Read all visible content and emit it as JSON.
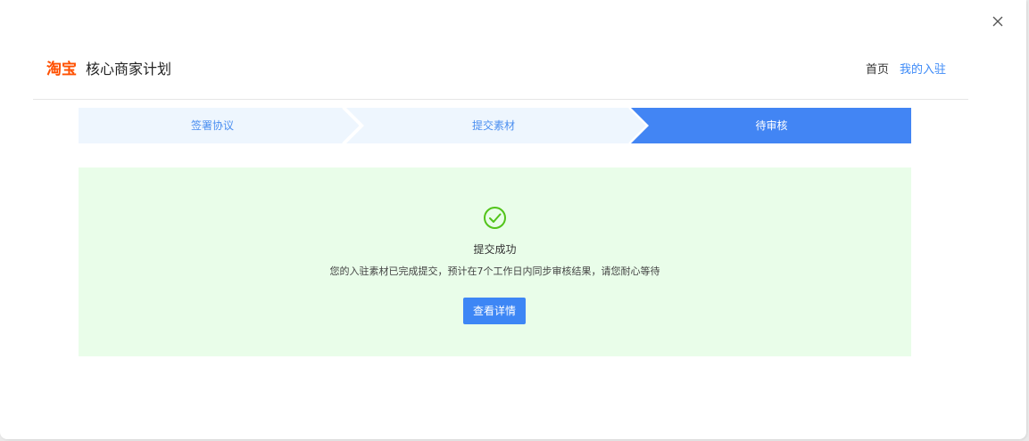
{
  "header": {
    "logo_text": "淘宝",
    "title": "核心商家计划",
    "nav": {
      "home": "首页",
      "my_entry": "我的入驻"
    }
  },
  "steps": [
    {
      "label": "签署协议",
      "state": "done"
    },
    {
      "label": "提交素材",
      "state": "done"
    },
    {
      "label": "待审核",
      "state": "active"
    }
  ],
  "result": {
    "title": "提交成功",
    "description": "您的入驻素材已完成提交，预计在7个工作日内同步审核结果，请您耐心等待",
    "button_label": "查看详情",
    "icon": "check-circle-icon"
  },
  "colors": {
    "brand": "#ff5000",
    "accent": "#3d86f5",
    "success": "#52c41a",
    "panel_bg": "#e9fde9",
    "step_inactive_bg": "#eef6fe"
  }
}
